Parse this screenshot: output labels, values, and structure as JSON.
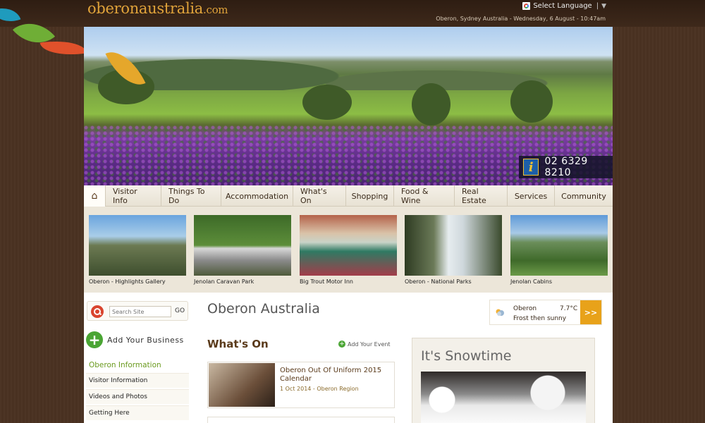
{
  "header": {
    "logo_name": "oberonaustralia",
    "logo_tld": ".com",
    "language_label": "Select Language",
    "language_arrow": "▼",
    "datetime": "Oberon, Sydney Australia - Wednesday, 6 August - 10:47am"
  },
  "hero": {
    "info_icon": "i",
    "phone": "02 6329 8210"
  },
  "nav": {
    "home_icon": "⌂",
    "items": [
      "Visitor Info",
      "Things To Do",
      "Accommodation",
      "What's On",
      "Shopping",
      "Food & Wine",
      "Real Estate",
      "Services",
      "Community"
    ]
  },
  "thumbnails": [
    {
      "caption": "Oberon - Highlights Gallery"
    },
    {
      "caption": "Jenolan Caravan Park"
    },
    {
      "caption": "Big Trout Motor Inn"
    },
    {
      "caption": "Oberon - National Parks"
    },
    {
      "caption": "Jenolan Cabins"
    }
  ],
  "sidebar": {
    "search_placeholder": "Search Site",
    "go_label": "GO",
    "plus_icon": "+",
    "add_business": "Add Your Business",
    "heading": "Oberon Information",
    "links": [
      "Visitor Information",
      "Videos and Photos",
      "Getting Here"
    ]
  },
  "main": {
    "title": "Oberon Australia",
    "whats_on": "What's On",
    "add_event_icon": "+",
    "add_event": "Add Your Event",
    "event": {
      "title": "Oberon Out Of Uniform 2015 Calendar",
      "meta": "1 Oct 2014 - Oberon Region"
    }
  },
  "weather": {
    "location": "Oberon",
    "temp": "7.7°C",
    "condition": "Frost then sunny",
    "button": ">>"
  },
  "feature": {
    "title": "It's Snowtime"
  }
}
